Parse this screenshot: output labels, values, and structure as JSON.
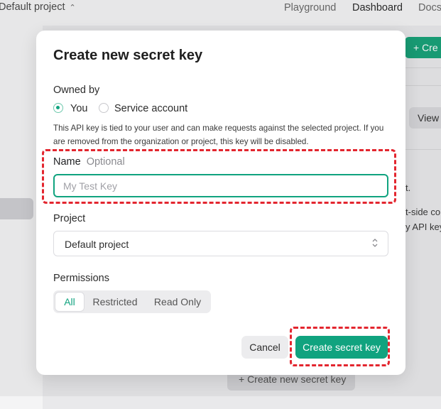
{
  "background": {
    "project_selector": "Default project",
    "nav": [
      "Playground",
      "Dashboard",
      "Docs"
    ],
    "create_button_partial": "+ Cre",
    "view_button_partial": "View",
    "text_fragments": [
      "t.",
      "t-side co",
      "y API key"
    ],
    "create_bottom_button": "+ Create new secret key"
  },
  "modal": {
    "title": "Create new secret key",
    "owned_by": {
      "label": "Owned by",
      "options": [
        "You",
        "Service account"
      ],
      "selected": "You"
    },
    "help_text": "This API key is tied to your user and can make requests against the selected project. If you are removed from the organization or project, this key will be disabled.",
    "name": {
      "label": "Name",
      "optional": "Optional",
      "placeholder": "My Test Key",
      "value": ""
    },
    "project": {
      "label": "Project",
      "selected": "Default project"
    },
    "permissions": {
      "label": "Permissions",
      "options": [
        "All",
        "Restricted",
        "Read Only"
      ],
      "selected": "All"
    },
    "cancel_label": "Cancel",
    "create_label": "Create secret key"
  },
  "colors": {
    "accent": "#10a37f",
    "annotation": "#e3262f"
  }
}
